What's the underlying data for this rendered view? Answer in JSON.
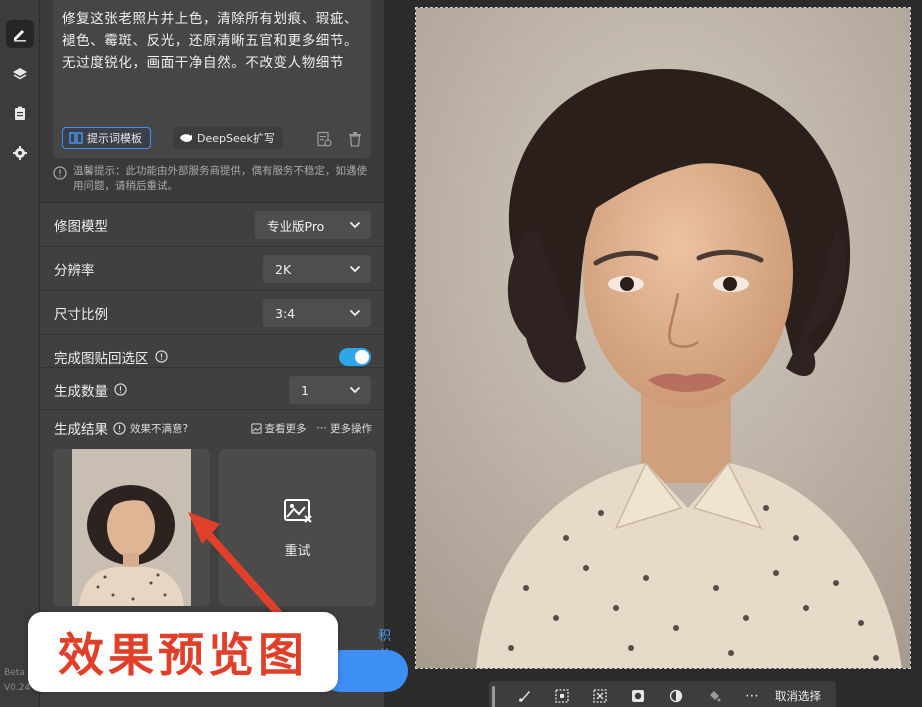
{
  "prompt": {
    "text": "修复这张老照片并上色，清除所有划痕、瑕疵、褪色、霉斑、反光，还原清晰五官和更多细节。无过度锐化，画面干净自然。不改变人物细节",
    "template_label": "提示词模板",
    "deepseek_label": "DeepSeek扩写"
  },
  "notice": "温馨提示：此功能由外部服务商提供，偶有服务不稳定，如遇使用问题，请稍后重试。",
  "settings": {
    "model": {
      "label": "修图模型",
      "value": "专业版Pro"
    },
    "resolution": {
      "label": "分辨率",
      "value": "2K"
    },
    "ratio": {
      "label": "尺寸比例",
      "value": "3:4"
    },
    "paste_back": {
      "label": "完成图贴回选区",
      "enabled": true
    },
    "count": {
      "label": "生成数量",
      "value": "1"
    }
  },
  "results": {
    "label": "生成结果",
    "unsatisfied": "效果不满意?",
    "view_more": "查看更多",
    "more_actions": "更多操作",
    "retry": "重试"
  },
  "credits_text": "积分",
  "rail_version": [
    "Beta",
    "V0.24"
  ],
  "toolbar": {
    "deselect": "取消选择"
  },
  "annotation": "效果预览图",
  "colors": {
    "accent": "#3d8ef5",
    "toggle": "#2ea7e8",
    "annotation": "#e0402a"
  }
}
